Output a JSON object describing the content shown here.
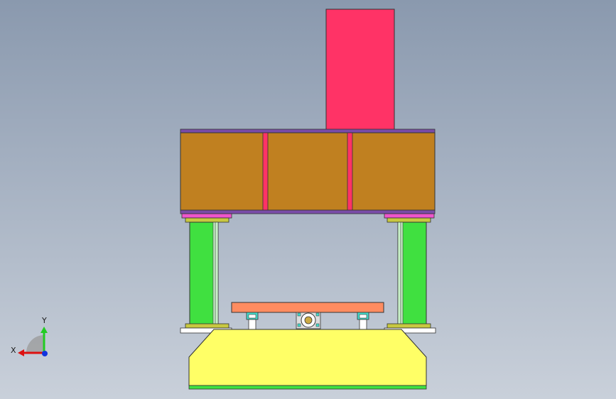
{
  "colors": {
    "cylinder": "#ff3366",
    "crown_block": "#c08020",
    "crown_rib": "#ff3366",
    "top_plate": "#7a4ca8",
    "magenta_pad": "#ee55cc",
    "column": "#40e040",
    "column_cap": "#c8c840",
    "slide_plate": "#ff8c60",
    "base_body": "#ffff66",
    "base_bottom": "#40e040",
    "guide_block": "#44ddcc",
    "white_block": "#ffffff",
    "axis_x": "#dd1111",
    "axis_y": "#22cc22",
    "axis_z": "#1133dd"
  },
  "triad": {
    "x_label": "X",
    "y_label": "Y"
  }
}
